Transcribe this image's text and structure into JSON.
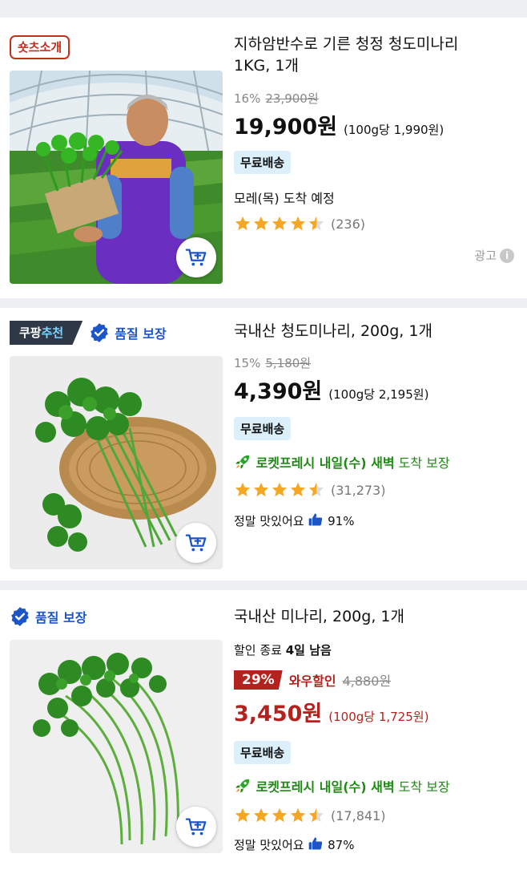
{
  "products": [
    {
      "badge": "숏츠소개",
      "title": "지하암반수로 기른 청정 청도미나리 1KG, 1개",
      "discount_pct": "16%",
      "original_price": "23,900원",
      "price": "19,900원",
      "unit_price": "(100g당 1,990원)",
      "shipping": "무료배송",
      "arrival": "모레(목) 도착 예정",
      "rating": 4.5,
      "review_count": "(236)",
      "ad_label": "광고"
    },
    {
      "badge_part1": "쿠팡",
      "badge_part2": "추천",
      "quality": "품질 보장",
      "title": "국내산 청도미나리, 200g, 1개",
      "discount_pct": "15%",
      "original_price": "5,180원",
      "price": "4,390원",
      "unit_price": "(100g당 2,195원)",
      "shipping": "무료배송",
      "rocket_bold": "로켓프레시 내일(수) 새벽",
      "rocket_rest": " 도착 보장",
      "rating": 4.5,
      "review_count": "(31,273)",
      "taste_label": "정말 맛있어요",
      "taste_pct": "91%"
    },
    {
      "quality": "품질 보장",
      "title": "국내산 미나리, 200g, 1개",
      "timer_prefix": "할인 종료 ",
      "timer_value": "4일 남음",
      "discount_pct": "29%",
      "wow_label": "와우할인",
      "original_price": "4,880원",
      "price": "3,450원",
      "unit_price": "(100g당 1,725원)",
      "shipping": "무료배송",
      "rocket_bold": "로켓프레시 내일(수) 새벽",
      "rocket_rest": " 도착 보장",
      "rating": 4.5,
      "review_count": "(17,841)",
      "taste_label": "정말 맛있어요",
      "taste_pct": "87%"
    }
  ],
  "icons": {
    "cart": "add-to-cart-icon",
    "star": "star-icon",
    "rocket": "rocket-icon",
    "thumb": "thumbs-up-icon",
    "check": "verified-check-icon",
    "info": "info-icon"
  },
  "colors": {
    "price_red": "#b3221d",
    "quality_blue": "#1c55c8",
    "rocket_green": "#1e8a14",
    "star_gold": "#f5a623",
    "free_bg": "#dcf0fb"
  }
}
